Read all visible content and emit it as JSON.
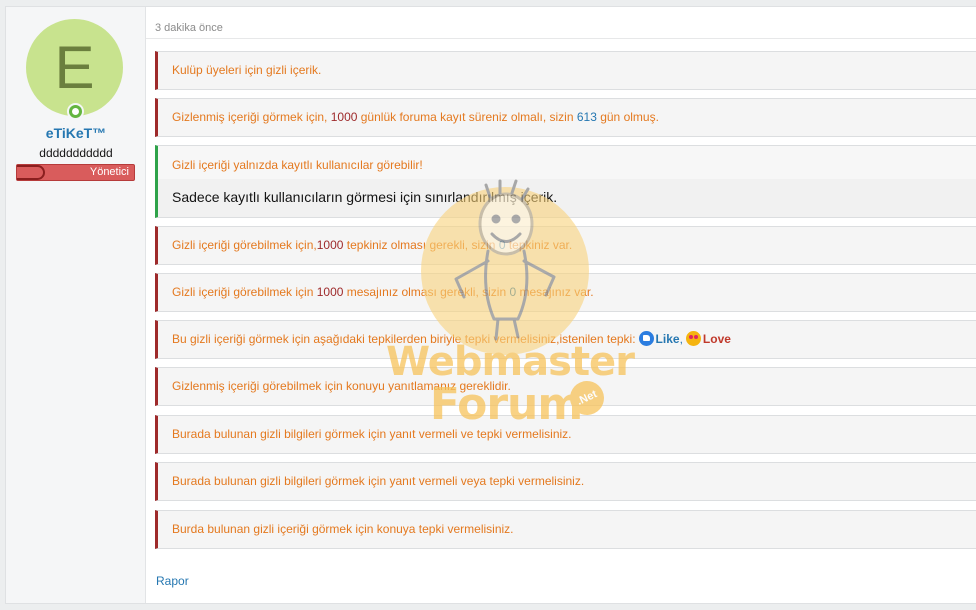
{
  "user": {
    "avatar_letter": "E",
    "username": "eTiKeT™",
    "title": "ddddddddddd",
    "banner": "Yönetici"
  },
  "post": {
    "timestamp": "3 dakika önce",
    "report_label": "Rapor"
  },
  "boxes": {
    "club": "Kulüp üyeleri için gizli içerik.",
    "days_pre": "Gizlenmiş içeriği görmek için, ",
    "days_required": "1000",
    "days_mid": " günlük foruma kayıt süreniz olmalı, sizin ",
    "days_current": "613",
    "days_post": " gün olmuş.",
    "registered_head": "Gizli içeriği yalnızda kayıtlı kullanıcılar görebilir!",
    "registered_body": "Sadece kayıtlı kullanıcıların görmesi için sınırlandırılmış içerik.",
    "reactions_pre": "Gizli içeriği görebilmek için,",
    "reactions_required": "1000",
    "reactions_mid": " tepkiniz olması gerekli, sizin ",
    "reactions_current": "0",
    "reactions_post": " tepkiniz var.",
    "messages_pre": "Gizli içeriği görebilmek için ",
    "messages_required": "1000",
    "messages_mid": " mesajınız olması gerekli, sizin ",
    "messages_current": "0",
    "messages_post": " mesajınız var.",
    "react_type_pre": "Bu gizli içeriği görmek için aşağıdaki tepkilerden biriyle tepki vermelisiniz,istenilen tepki:",
    "react_like": "Like",
    "react_sep": ",",
    "react_love": "Love",
    "reply": "Gizlenmiş içeriği görebilmek için konuyu yanıtlamanız gereklidir.",
    "reply_and_react": "Burada bulunan gizli bilgileri görmek için yanıt vermeli ve tepki vermelisiniz.",
    "reply_or_react": "Burada bulunan gizli bilgileri görmek için yanıt vermeli veya tepki vermelisiniz.",
    "react_only": "Burda bulunan gizli içeriği görmek için konuya tepki vermelisiniz."
  },
  "watermark": {
    "line1": "Webmaster",
    "line2": "Forum",
    "badge": ".Net"
  },
  "colors": {
    "hidden_text": "#e4791f",
    "hidden_border": "#9e2a2b",
    "ok_border": "#2fa34a",
    "link": "#2577b1",
    "banner": "#d95c5c"
  }
}
